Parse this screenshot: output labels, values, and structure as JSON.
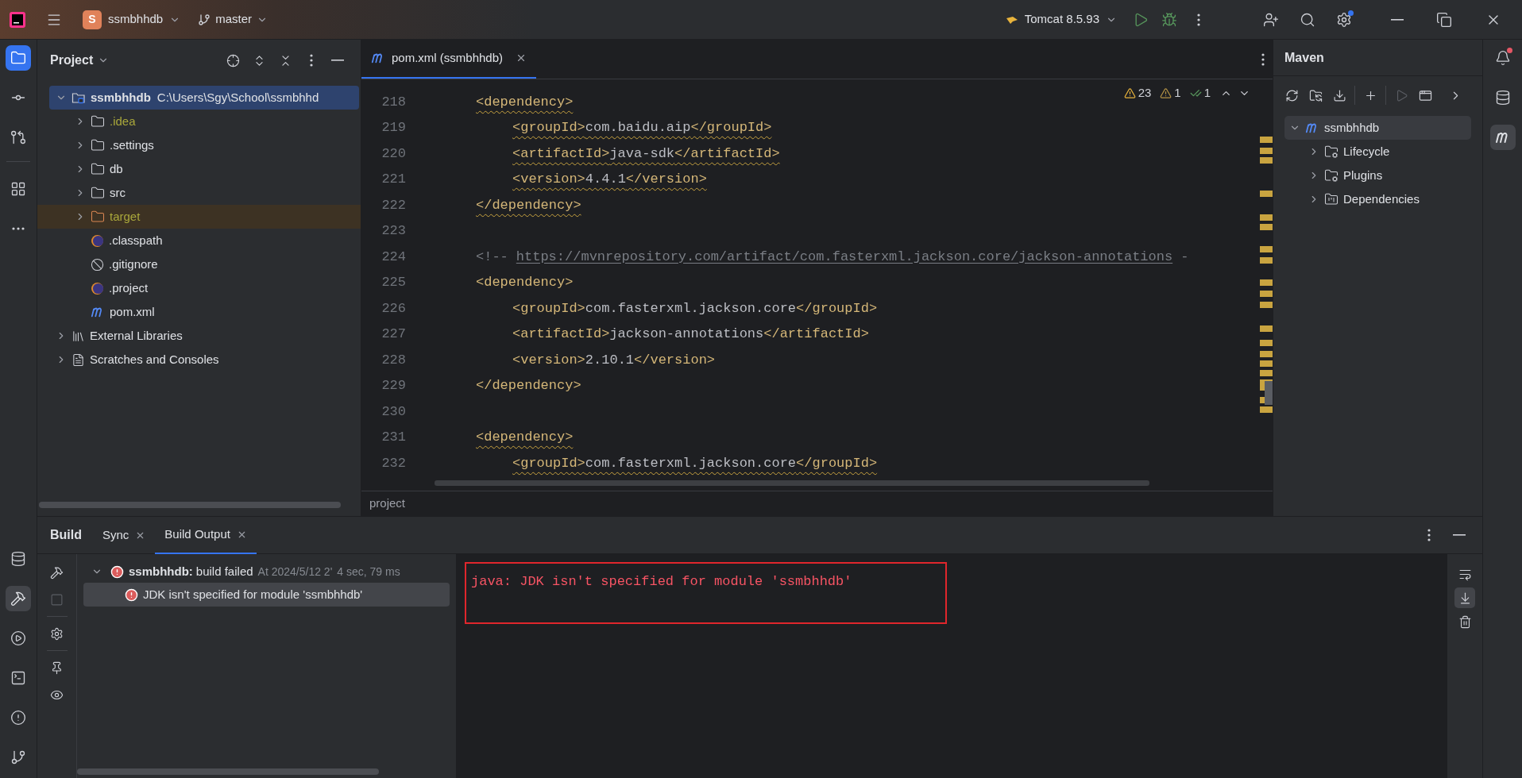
{
  "title_bar": {
    "project_badge": "S",
    "project": "ssmbhhdb",
    "branch": "master",
    "run_config": "Tomcat 8.5.93"
  },
  "left_toolbar": {
    "top": [
      {
        "kind": "project",
        "selected": true
      },
      {
        "kind": "commit",
        "selected": false
      },
      {
        "kind": "pull-requests",
        "selected": false
      },
      {
        "kind": "structure",
        "selected": false
      },
      {
        "kind": "more",
        "selected": false
      }
    ],
    "bottom": [
      {
        "kind": "database",
        "selected": false
      },
      {
        "kind": "build",
        "selected": true
      },
      {
        "kind": "services",
        "selected": false
      },
      {
        "kind": "terminal",
        "selected": false
      },
      {
        "kind": "problems",
        "selected": false
      },
      {
        "kind": "git",
        "selected": false
      }
    ]
  },
  "right_toolbar": [
    {
      "kind": "notifications",
      "selected": false,
      "unread": true
    },
    {
      "kind": "database",
      "selected": false,
      "unread": false
    },
    {
      "kind": "maven",
      "selected": true,
      "unread": false
    }
  ],
  "project_panel": {
    "title": "Project",
    "tree": [
      {
        "kind": "module",
        "label": "ssmbhhdb",
        "path": "C:\\Users\\Sgy\\School\\ssmbhhd",
        "expanded": true,
        "selected": true,
        "ignored": false,
        "excluded": false,
        "children": [
          {
            "kind": "folder",
            "label": ".idea",
            "expanded": false,
            "selected": false,
            "ignored": true,
            "excluded": false
          },
          {
            "kind": "folder",
            "label": ".settings",
            "expanded": false,
            "selected": false,
            "ignored": false,
            "excluded": false
          },
          {
            "kind": "folder",
            "label": "db",
            "expanded": false,
            "selected": false,
            "ignored": false,
            "excluded": false
          },
          {
            "kind": "folder",
            "label": "src",
            "expanded": false,
            "selected": false,
            "ignored": false,
            "excluded": false
          },
          {
            "kind": "folder",
            "label": "target",
            "expanded": false,
            "selected": false,
            "ignored": true,
            "excluded": true
          },
          {
            "kind": "eclipse",
            "label": ".classpath",
            "selected": false,
            "ignored": false,
            "excluded": false
          },
          {
            "kind": "gitignore",
            "label": ".gitignore",
            "selected": false,
            "ignored": false,
            "excluded": false
          },
          {
            "kind": "eclipse",
            "label": ".project",
            "selected": false,
            "ignored": false,
            "excluded": false
          },
          {
            "kind": "maven",
            "label": "pom.xml",
            "selected": false,
            "ignored": false,
            "excluded": false
          }
        ]
      },
      {
        "kind": "libraries",
        "label": "External Libraries",
        "expanded": false,
        "selected": false,
        "ignored": false,
        "excluded": false
      },
      {
        "kind": "scratches",
        "label": "Scratches and Consoles",
        "expanded": false,
        "selected": false,
        "ignored": false,
        "excluded": false
      }
    ]
  },
  "editor": {
    "tab": {
      "label": "pom.xml (ssmbhhdb)",
      "selected": true
    },
    "inspections": {
      "warnings": "23",
      "weak_warnings": "1",
      "typos": "1"
    },
    "lines": [
      {
        "number": "218",
        "kind": "outer",
        "text": "<dependency>",
        "warning": true
      },
      {
        "number": "219",
        "kind": "inner",
        "text": "<groupId>com.baidu.aip</groupId>",
        "warning": true
      },
      {
        "number": "220",
        "kind": "inner",
        "text": "<artifactId>java-sdk</artifactId>",
        "warning": true
      },
      {
        "number": "221",
        "kind": "inner",
        "text": "<version>4.4.1</version>",
        "warning": true
      },
      {
        "number": "222",
        "kind": "outer",
        "text": "</dependency>",
        "warning": true
      },
      {
        "number": "223",
        "kind": "blank"
      },
      {
        "number": "224",
        "kind": "comment",
        "text": "<!--",
        "link": "https://mvnrepository.com/artifact/com.fasterxml.jackson.core/jackson-annotations",
        "tail": "-",
        "warning": false
      },
      {
        "number": "225",
        "kind": "outer",
        "text": "<dependency>",
        "warning": false
      },
      {
        "number": "226",
        "kind": "inner",
        "text": "<groupId>com.fasterxml.jackson.core</groupId>",
        "warning": false
      },
      {
        "number": "227",
        "kind": "inner",
        "text": "<artifactId>jackson-annotations</artifactId>",
        "warning": false
      },
      {
        "number": "228",
        "kind": "inner",
        "text": "<version>2.10.1</version>",
        "warning": false
      },
      {
        "number": "229",
        "kind": "outer",
        "text": "</dependency>",
        "warning": false
      },
      {
        "number": "230",
        "kind": "blank"
      },
      {
        "number": "231",
        "kind": "outer",
        "text": "<dependency>",
        "warning": true
      },
      {
        "number": "232",
        "kind": "inner",
        "text": "<groupId>com.fasterxml.jackson.core</groupId>",
        "warning": true
      }
    ],
    "breadcrumb": "project"
  },
  "maven": {
    "title": "Maven",
    "toolbar": [
      {
        "kind": "reload",
        "disabled": false
      },
      {
        "kind": "reimport",
        "disabled": false
      },
      {
        "kind": "download",
        "disabled": false
      },
      {
        "kind": "add",
        "disabled": false
      },
      {
        "kind": "run",
        "disabled": true
      },
      {
        "kind": "execute",
        "disabled": false
      },
      {
        "kind": "more",
        "disabled": false
      }
    ],
    "tree": [
      {
        "kind": "project",
        "label": "ssmbhhdb",
        "expanded": true,
        "selected": true,
        "children": [
          {
            "kind": "lifecycle",
            "label": "Lifecycle",
            "expanded": false,
            "selected": false
          },
          {
            "kind": "plugins",
            "label": "Plugins",
            "expanded": false,
            "selected": false
          },
          {
            "kind": "dependencies",
            "label": "Dependencies",
            "expanded": false,
            "selected": false
          }
        ]
      }
    ]
  },
  "build": {
    "title": "Build",
    "tabs": [
      {
        "label": "Sync",
        "selected": false
      },
      {
        "label": "Build Output",
        "selected": true
      }
    ],
    "side_toolbar": [
      {
        "kind": "build",
        "disabled": false
      },
      {
        "kind": "stop",
        "disabled": true
      },
      {
        "kind": "settings",
        "disabled": false
      },
      {
        "kind": "pin",
        "disabled": false
      },
      {
        "kind": "view",
        "disabled": false
      }
    ],
    "tree": [
      {
        "kind": "error",
        "label": "ssmbhhdb:",
        "status": "build failed",
        "time": "At 2024/5/12 2'",
        "duration": "4 sec, 79 ms",
        "expanded": true,
        "selected": false,
        "children": [
          {
            "kind": "error",
            "label": "JDK isn't specified for module 'ssmbhhdb'",
            "selected": true
          }
        ]
      }
    ],
    "output": {
      "text": "java: JDK isn't specified for module 'ssmbhhdb'",
      "highlighted": true
    },
    "output_toolbar": [
      {
        "kind": "wrap",
        "selected": false
      },
      {
        "kind": "scroll-end",
        "selected": true
      },
      {
        "kind": "clear",
        "selected": false
      }
    ]
  }
}
